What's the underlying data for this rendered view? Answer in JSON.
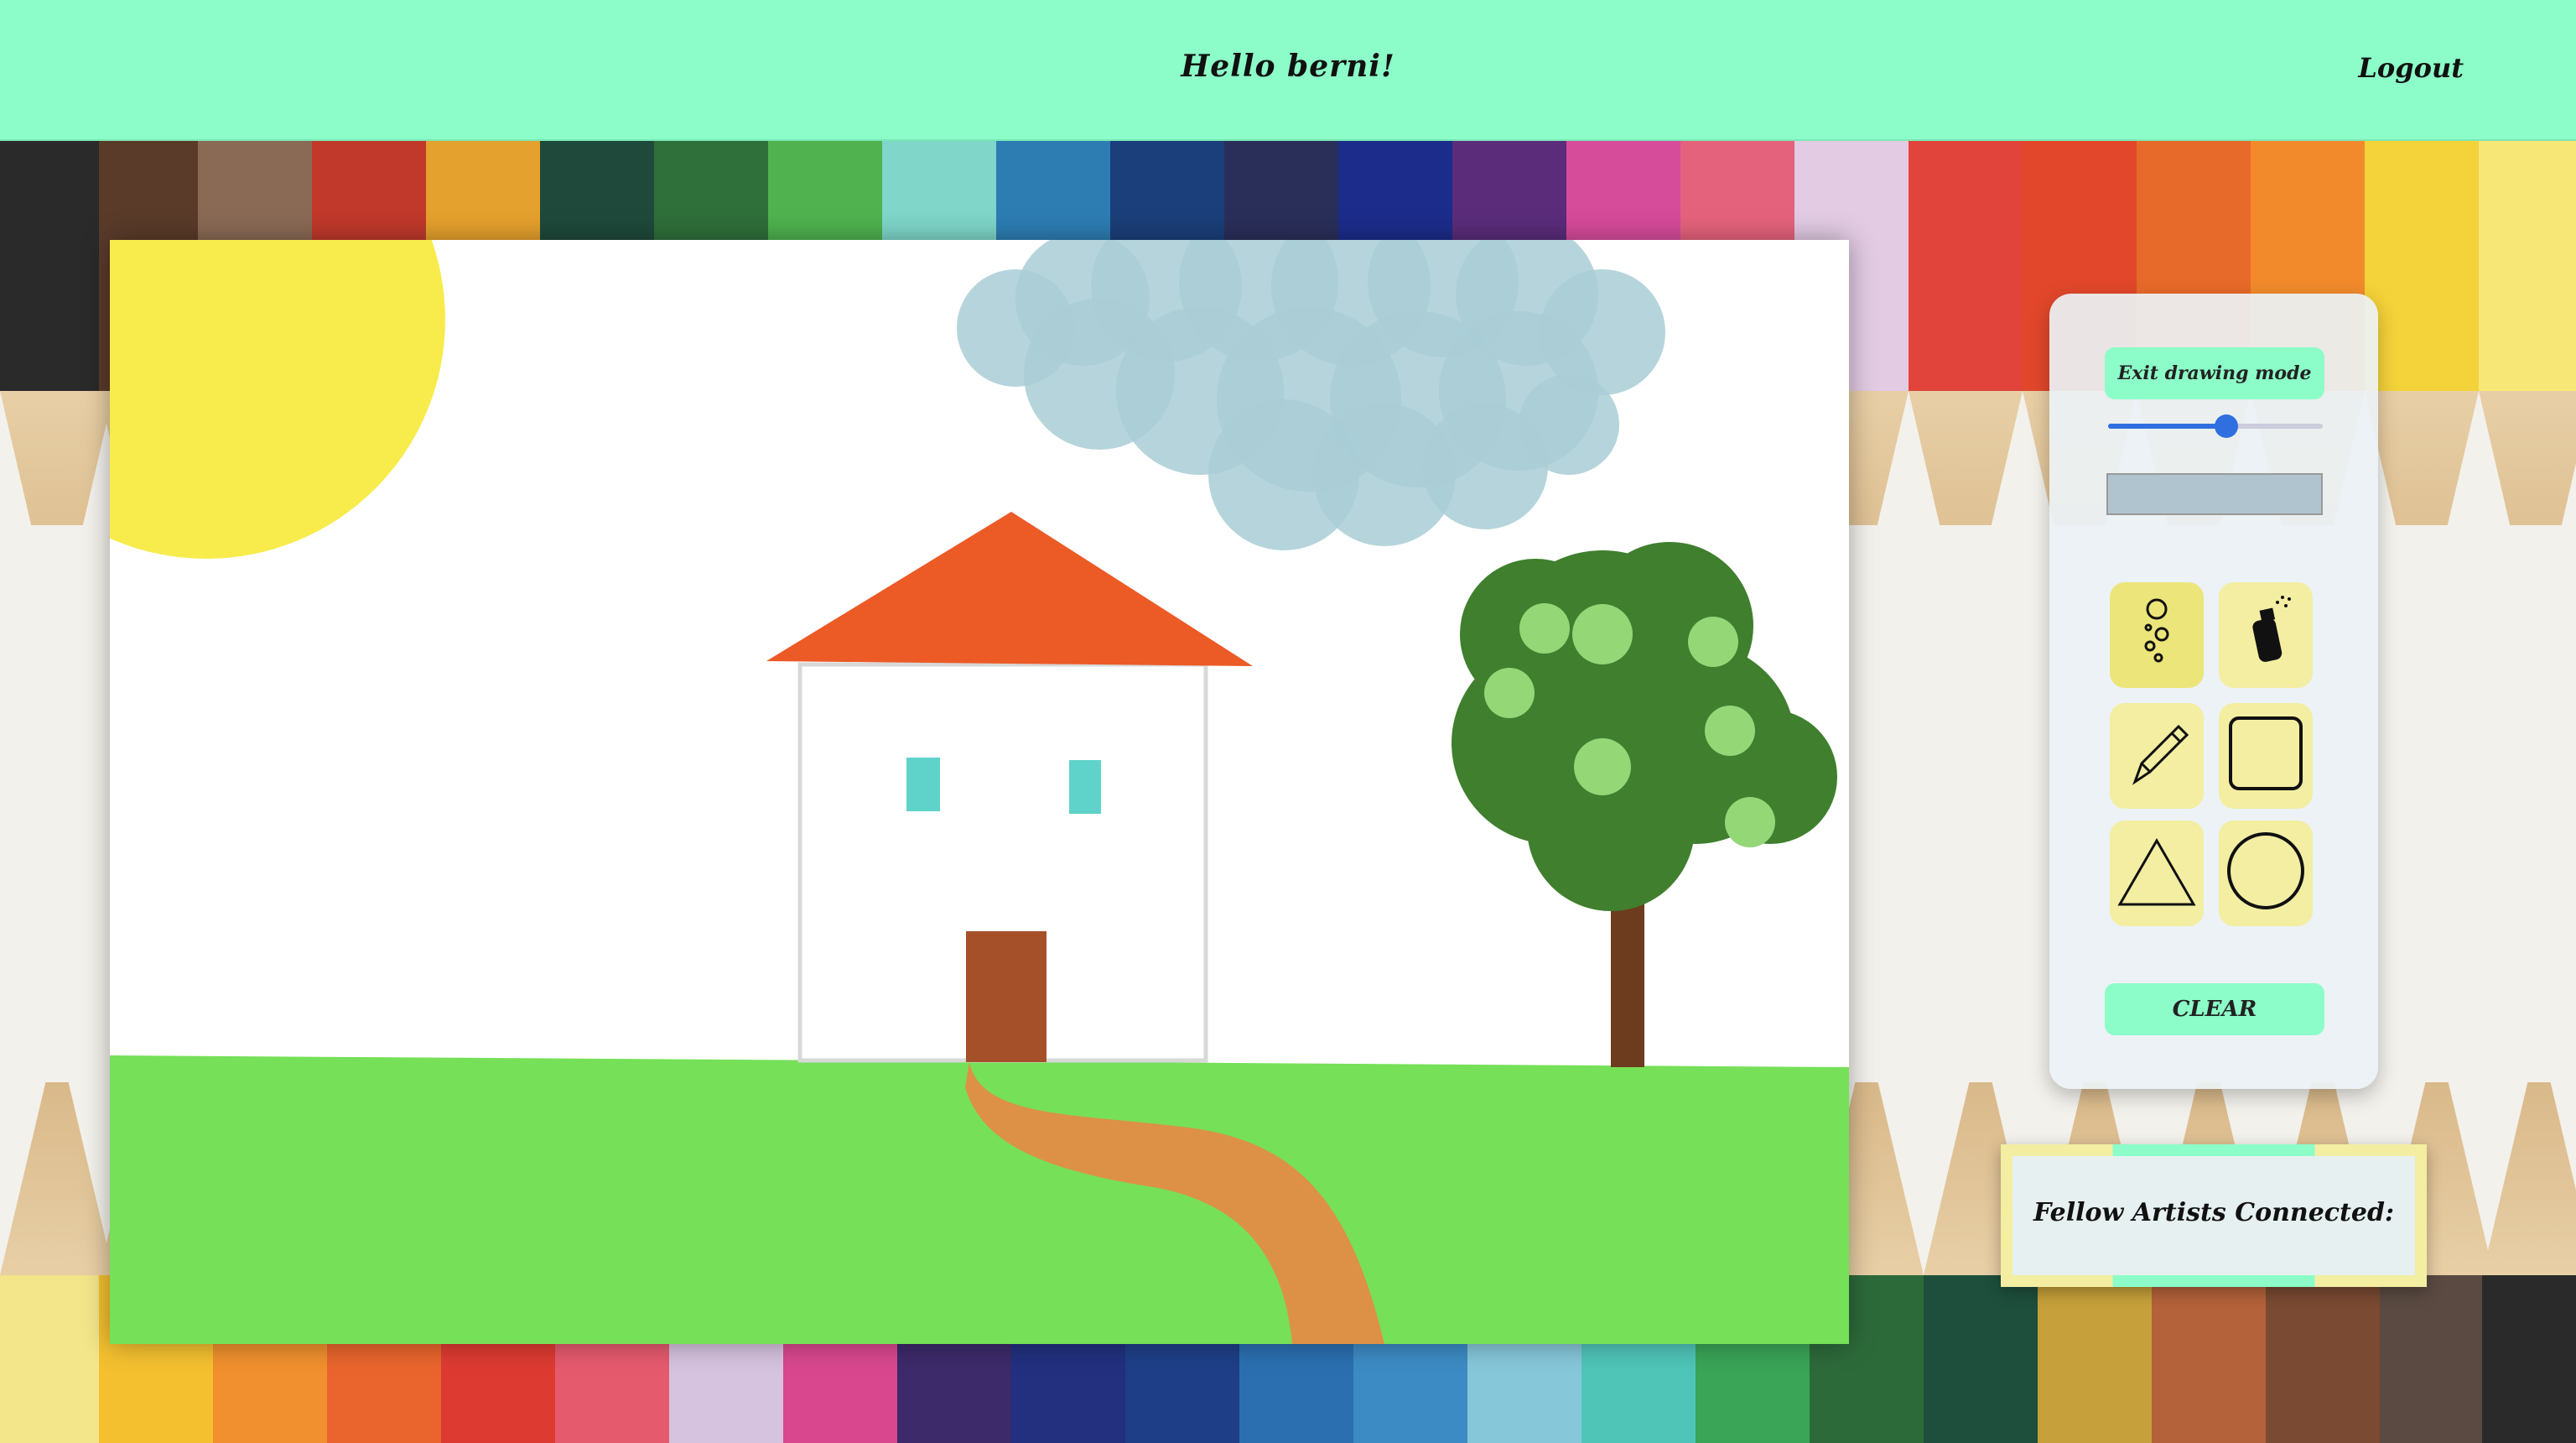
{
  "header": {
    "greeting": "Hello berni!",
    "logout_label": "Logout"
  },
  "toolbar": {
    "exit_label": "Exit drawing mode",
    "brush_size": 0.55,
    "current_color": "#b0c4cf",
    "tools": [
      {
        "name": "bubble-brush",
        "icon": "bubbles-icon",
        "active": true
      },
      {
        "name": "spray",
        "icon": "spray-can-icon",
        "active": false
      },
      {
        "name": "pencil",
        "icon": "pencil-icon",
        "active": false
      },
      {
        "name": "square",
        "icon": "square-icon",
        "active": false
      },
      {
        "name": "triangle",
        "icon": "triangle-icon",
        "active": false
      },
      {
        "name": "circle",
        "icon": "circle-icon",
        "active": false
      }
    ],
    "clear_label": "CLEAR"
  },
  "connected": {
    "label": "Fellow Artists Connected:"
  },
  "colors": {
    "accent": "#8cfdc8",
    "tool_bg": "#f3eea2",
    "sun": "#f7ec4b",
    "roof": "#ec5a26",
    "grass": "#76e058",
    "cloud": "#a9ccd6",
    "tree_leaves": "#3f7f2e",
    "path": "#dd9147"
  }
}
